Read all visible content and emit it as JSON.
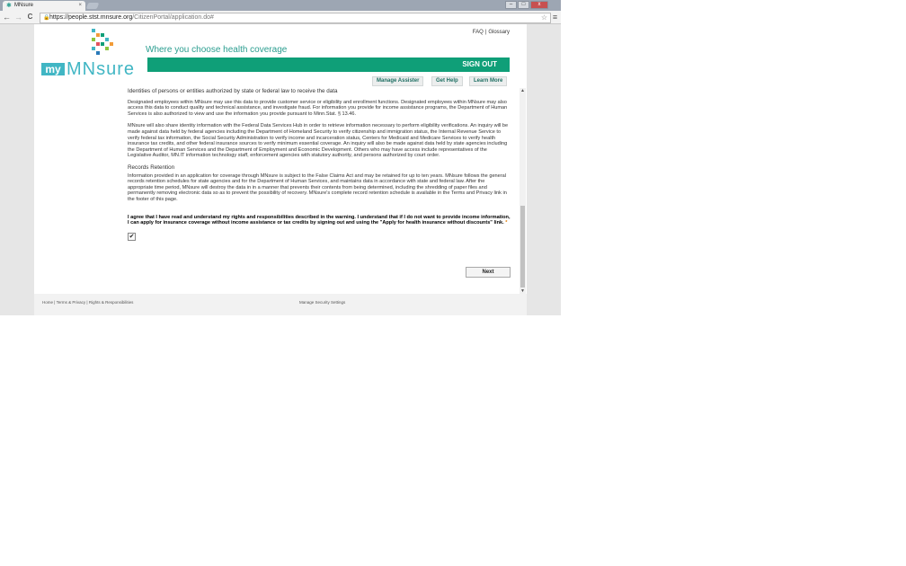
{
  "browser": {
    "tab_title": "MNsure",
    "tab_close": "×",
    "url_host": "https://people.stst.mnsure.org",
    "url_path": "/CitizenPortal/application.do#",
    "back": "←",
    "forward": "→",
    "reload": "C",
    "lock": "🔒",
    "star": "☆",
    "menu": "≡",
    "win_min": "–",
    "win_max": "□",
    "win_close": "x"
  },
  "header": {
    "logo_badge": "my",
    "logo_word": "MNsure",
    "tagline": "Where you choose health coverage",
    "faq": "FAQ",
    "separator": "|",
    "glossary": "Glossary",
    "sign_out": "SIGN OUT"
  },
  "nav": {
    "manage_assister": "Manage Assister",
    "get_help": "Get Help",
    "learn_more": "Learn More"
  },
  "content": {
    "intro_heading": "Identities of persons or entities authorized by state or federal law to receive the data",
    "paragraph_1": "Designated employees within MNsure may use this data to provide customer service or eligibility and enrollment functions. Designated employees within MNsure may also access this data to conduct quality and technical assistance, and investigate fraud. For information you provide for income assistance programs, the Department of Human Services is also authorized to view and use the information you provide pursuant to Minn.Stat. § 13.46.",
    "paragraph_2": "MNsure will also share identity information with the Federal Data Services Hub in order to retrieve information necessary to perform eligibility verifications. An inquiry will be made against data held by federal agencies including the Department of Homeland Security to verify citizenship and immigration status, the Internal Revenue Service to verify federal tax information, the Social Security Administration to verify income and incarceration status, Centers for Medicaid and Medicare Services to verify health insurance tax credits, and other federal insurance sources to verify minimum essential coverage. An inquiry will also be made against data held by state agencies including the Department of Human Services and the Department of Employment and Economic Development. Others who may have access include representatives of the Legislative Auditor, MN.IT information technology staff, enforcement agencies with statutory authority, and persons authorized by court order.",
    "records_heading": "Records Retention",
    "paragraph_3": "Information provided in an application for coverage through MNsure is subject to the False Claims Act and may be retained for up to ten years. MNsure follows the general records retention schedules for state agencies and for the Department of Human Services, and maintains data in accordance with state and federal law. After the appropriate time period, MNsure will destroy the data in in a manner that prevents their contents from being determined, including the shredding of paper files and permanently removing electronic data so as to prevent the possibility of recovery. MNsure's complete record retention schedule is available in the Terms and Privacy link in the footer of this page.",
    "agreement": "I agree that I have read and understand my rights and responsibilities described in the warning. I understand that if I do not want to provide income information, I can apply for insurance coverage without income assistance or tax credits by signing out and using the \"Apply for health insurance without discounts\" link.",
    "required_marker": "*",
    "agreement_checked": true,
    "check_mark": "✔",
    "next_button": "Next"
  },
  "scrollbar": {
    "up": "▲",
    "down": "▼"
  },
  "footer": {
    "home": "Home",
    "sep": "|",
    "terms": "Terms & Privacy",
    "rights": "Rights & Responsibilities",
    "security": "Manage Security Settings"
  },
  "colors": {
    "brand_teal": "#41b6c4",
    "banner_green": "#0f9f78",
    "tagline": "#2a9d8f",
    "required": "#e07a00"
  }
}
